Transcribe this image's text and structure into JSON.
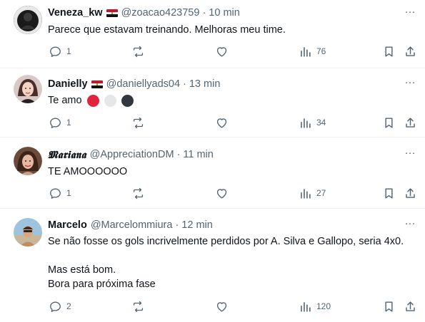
{
  "tweets": [
    {
      "name": "Veneza_kw",
      "handle": "@zoacao423759",
      "time": "10 min",
      "text": [
        "Parece que estavam treinando. Melhoras meu time."
      ],
      "replies": "1",
      "views": "76",
      "flag": true
    },
    {
      "name": "Danielly",
      "handle": "@daniellyads04",
      "time": "13 min",
      "text": [
        "Te amo"
      ],
      "emoji_colors": [
        "#e0243b",
        "#e6e7e9",
        "#31373d"
      ],
      "replies": "1",
      "views": "34",
      "flag": true
    },
    {
      "name": "𝕸𝖆𝖗𝖎𝖆𝖓𝖆",
      "handle": "@AppreciationDM",
      "time": "11 min",
      "text": [
        "TE AMOOOOOO"
      ],
      "replies": "1",
      "views": "27",
      "flag": false
    },
    {
      "name": "Marcelo",
      "handle": "@Marcelommiura",
      "time": "12 min",
      "text": [
        "Se não fosse os gols incrivelmente perdidos por A. Silva e Gallopo, seria 4x0.",
        "",
        "Mas está bom.",
        "Bora para próxima fase"
      ],
      "replies": "2",
      "views": "120",
      "flag": false
    }
  ],
  "separator": "·",
  "icons": {
    "more": "more-horizontal-icon",
    "reply": "reply-icon",
    "retweet": "retweet-icon",
    "like": "heart-icon",
    "views": "views-chart-icon",
    "bookmark": "bookmark-icon",
    "share": "share-icon"
  },
  "colors": {
    "text": "#0f1419",
    "secondary": "#536471",
    "divider": "#eff3f4"
  }
}
